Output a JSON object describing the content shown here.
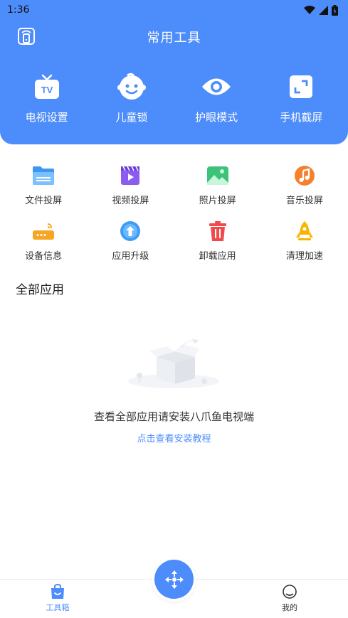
{
  "status_bar": {
    "time": "1:36"
  },
  "header": {
    "title": "常用工具"
  },
  "top_tools": [
    {
      "label": "电视设置",
      "icon": "tv-icon"
    },
    {
      "label": "儿童锁",
      "icon": "child-face-icon"
    },
    {
      "label": "护眼模式",
      "icon": "eye-icon"
    },
    {
      "label": "手机截屏",
      "icon": "screenshot-icon"
    }
  ],
  "grid_tools": [
    {
      "label": "文件投屏",
      "icon": "folder-icon"
    },
    {
      "label": "视频投屏",
      "icon": "video-icon"
    },
    {
      "label": "照片投屏",
      "icon": "photo-icon"
    },
    {
      "label": "音乐投屏",
      "icon": "music-icon"
    },
    {
      "label": "设备信息",
      "icon": "router-icon"
    },
    {
      "label": "应用升级",
      "icon": "upgrade-icon"
    },
    {
      "label": "卸载应用",
      "icon": "trash-icon"
    },
    {
      "label": "清理加速",
      "icon": "rocket-icon"
    }
  ],
  "apps_section": {
    "title": "全部应用",
    "empty_message": "查看全部应用请安装八爪鱼电视端",
    "tutorial_link": "点击查看安装教程"
  },
  "bottom_nav": {
    "tools_label": "工具箱",
    "mine_label": "我的"
  },
  "colors": {
    "primary": "#4d8cfb",
    "text": "#333333"
  }
}
